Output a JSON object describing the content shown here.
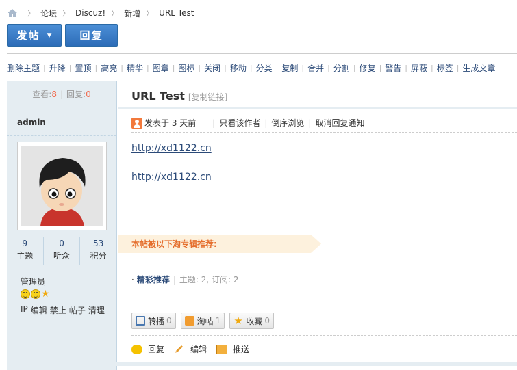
{
  "breadcrumb": {
    "items": [
      "论坛",
      "Discuz!",
      "新增",
      "URL Test"
    ]
  },
  "buttons": {
    "post": "发帖",
    "reply": "回复"
  },
  "modbar": {
    "items": [
      "删除主题",
      "升降",
      "置顶",
      "高亮",
      "精华",
      "图章",
      "图标",
      "关闭",
      "移动",
      "分类",
      "复制",
      "合并",
      "分割",
      "修复",
      "警告",
      "屏蔽",
      "标签",
      "生成文章"
    ]
  },
  "sidebar": {
    "views_label": "查看:",
    "views": "8",
    "replies_label": "回复:",
    "replies": "0",
    "username": "admin",
    "stats": [
      {
        "value": "9",
        "label": "主题"
      },
      {
        "value": "0",
        "label": "听众"
      },
      {
        "value": "53",
        "label": "积分"
      }
    ],
    "group": "管理员",
    "ops": [
      "IP",
      "编辑",
      "禁止",
      "帖子",
      "清理"
    ]
  },
  "post": {
    "title": "URL Test",
    "copy_link": "[复制链接]",
    "posted": "发表于 3 天前",
    "only_author": "只看该作者",
    "reverse": "倒序浏览",
    "cancel_notify": "取消回复通知",
    "link1": "http://xd1122.cn",
    "link2": "http://xd1122.cn",
    "recommend": "本帖被以下淘专辑推荐:",
    "topic_name": "精彩推荐",
    "topic_info": "主题: 2, 订阅: 2",
    "actions": [
      {
        "label": "转播",
        "count": "0"
      },
      {
        "label": "淘帖",
        "count": "1"
      },
      {
        "label": "收藏",
        "count": "0"
      }
    ],
    "footer": [
      "回复",
      "编辑",
      "推送"
    ]
  },
  "colors": {
    "accent_blue": "#2d6cb8",
    "link": "#2b4a78",
    "highlight_orange": "#e56e2d",
    "panel_bg": "#e5edf2"
  }
}
